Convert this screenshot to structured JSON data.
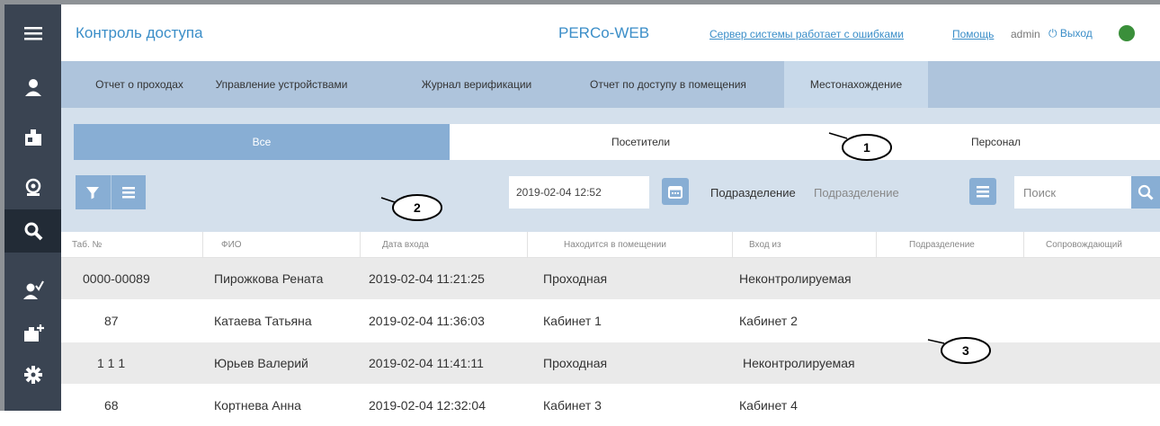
{
  "header": {
    "title": "Контроль доступа",
    "brand": "PERCo-WEB",
    "server_status_link": "Сервер системы работает с ошибками",
    "help_link": "Помощь",
    "user": "admin",
    "logout": "⏻ Выход",
    "status_color": "#3a8f3a"
  },
  "sidebar": {
    "items": [
      {
        "icon": "menu-icon"
      },
      {
        "icon": "person-icon"
      },
      {
        "icon": "badge-icon"
      },
      {
        "icon": "idcard-icon"
      },
      {
        "icon": "search-icon",
        "active": true
      },
      {
        "icon": "person-check-icon"
      },
      {
        "icon": "add-badge-icon"
      },
      {
        "icon": "gear-icon"
      }
    ]
  },
  "tabs": [
    {
      "label": "Отчет о проходах"
    },
    {
      "label": "Управление устройствами"
    },
    {
      "label": "Журнал верификации"
    },
    {
      "label": "Отчет по доступу в помещения"
    },
    {
      "label": "Местонахождение",
      "active": true
    }
  ],
  "segments": {
    "all": "Все",
    "visitors": "Посетители",
    "staff": "Персонал"
  },
  "filters": {
    "datetime": "2019-02-04 12:52",
    "department_label": "Подразделение",
    "department_placeholder": "Подразделение",
    "search_placeholder": "Поиск"
  },
  "callouts": [
    "1",
    "2",
    "3"
  ],
  "table": {
    "columns": [
      "Таб. №",
      "ФИО",
      "Дата входа",
      "Находится в помещении",
      "Вход из",
      "Подразделение",
      "Сопровождающий"
    ],
    "rows": [
      {
        "tab": "0000-00089",
        "name": "Пирожкова Рената",
        "date": "2019-02-04 11:21:25",
        "room": "Проходная",
        "from": "Неконтролируемая",
        "dept": "",
        "escort": ""
      },
      {
        "tab": "87",
        "name": "Катаева Татьяна",
        "date": "2019-02-04 11:36:03",
        "room": "Кабинет 1",
        "from": "Кабинет 2",
        "dept": "",
        "escort": ""
      },
      {
        "tab": "1 1 1",
        "name": "Юрьев Валерий",
        "date": "2019-02-04 11:41:11",
        "room": "Проходная",
        "from": "Неконтролируемая",
        "dept": "",
        "escort": ""
      },
      {
        "tab": "68",
        "name": "Кортнева Анна",
        "date": "2019-02-04 12:32:04",
        "room": "Кабинет 3",
        "from": "Кабинет 4",
        "dept": "",
        "escort": ""
      }
    ]
  }
}
